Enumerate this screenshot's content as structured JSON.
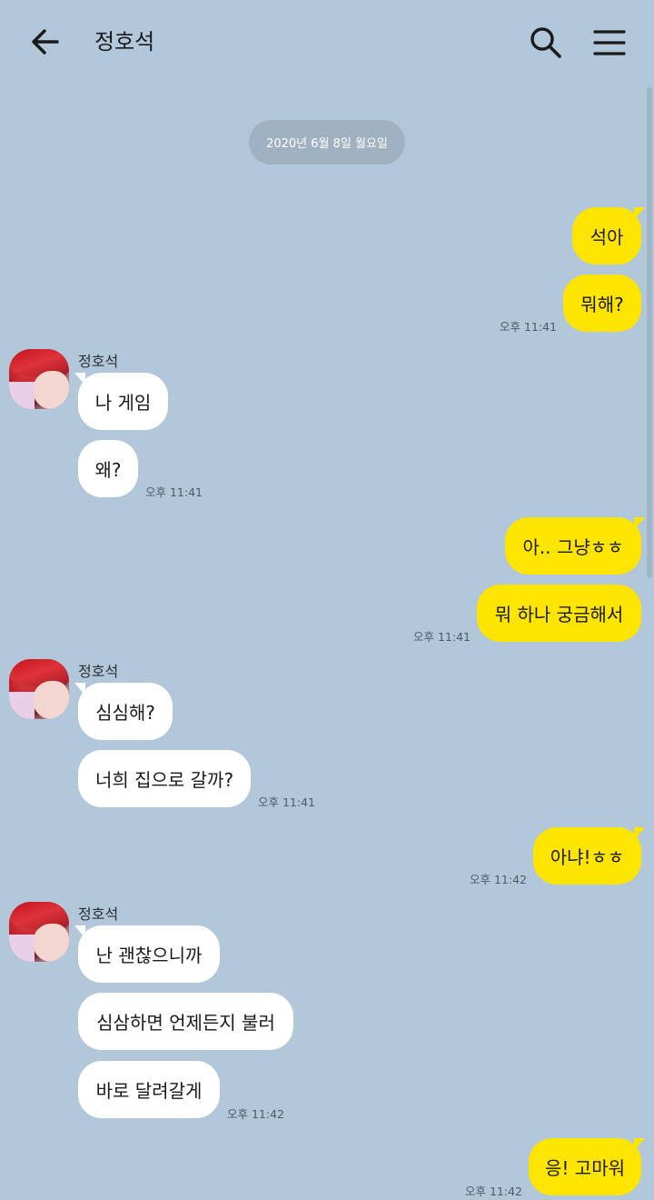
{
  "header": {
    "title": "정호석"
  },
  "date_separator": "2020년 6월 8일 월요일",
  "colors": {
    "background": "#b2c7da",
    "my_bubble": "#fee500",
    "their_bubble": "#ffffff"
  },
  "messages": [
    {
      "sender": "me",
      "text": "석아"
    },
    {
      "sender": "me",
      "text": "뭐해?",
      "time": "오후 11:41"
    },
    {
      "sender": "정호석",
      "text": "나 게임"
    },
    {
      "sender": "정호석",
      "text": "왜?",
      "time": "오후 11:41"
    },
    {
      "sender": "me",
      "text": "아.. 그냥ㅎㅎ"
    },
    {
      "sender": "me",
      "text": "뭐 하나 궁금해서",
      "time": "오후 11:41"
    },
    {
      "sender": "정호석",
      "text": "심심해?"
    },
    {
      "sender": "정호석",
      "text": "너희 집으로 갈까?",
      "time": "오후 11:41"
    },
    {
      "sender": "me",
      "text": "아냐!ㅎㅎ",
      "time": "오후 11:42"
    },
    {
      "sender": "정호석",
      "text": "난 괜찮으니까"
    },
    {
      "sender": "정호석",
      "text": "심삼하면 언제든지 불러"
    },
    {
      "sender": "정호석",
      "text": "바로 달려갈게",
      "time": "오후 11:42"
    },
    {
      "sender": "me",
      "text": "응! 고마워",
      "time": "오후 11:42"
    }
  ],
  "sender_names": [
    "정호석",
    "정호석",
    "정호석"
  ]
}
